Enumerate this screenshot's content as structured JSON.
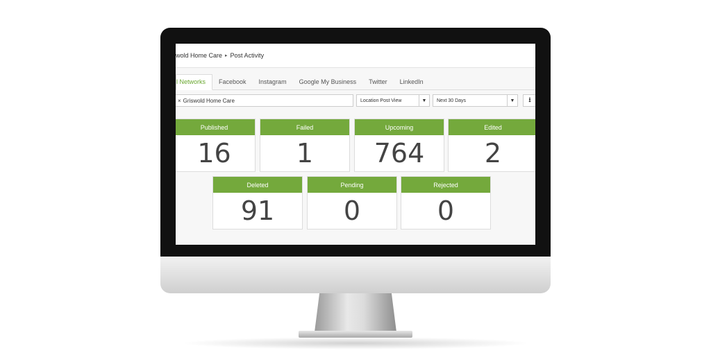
{
  "breadcrumb": {
    "parent": "wold Home Care",
    "separator": "▸",
    "current": "Post Activity"
  },
  "tabs": [
    "l Networks",
    "Facebook",
    "Instagram",
    "Google My Business",
    "Twitter",
    "LinkedIn"
  ],
  "filter": {
    "chip_remove": "×",
    "chip_label": "Griswold Home Care"
  },
  "view_select": {
    "value": "Location Post View",
    "arrow": "▼"
  },
  "range_select": {
    "value": "Next 30 Days",
    "arrow": "▼"
  },
  "download_icon": "⭳",
  "stats": [
    {
      "label": "Published",
      "value": "16"
    },
    {
      "label": "Failed",
      "value": "1"
    },
    {
      "label": "Upcoming",
      "value": "764"
    },
    {
      "label": "Edited",
      "value": "2"
    },
    {
      "label": "Deleted",
      "value": "91"
    },
    {
      "label": "Pending",
      "value": "0"
    },
    {
      "label": "Rejected",
      "value": "0"
    }
  ],
  "colors": {
    "accent": "#74a93c",
    "active_tab": "#6aa830"
  }
}
